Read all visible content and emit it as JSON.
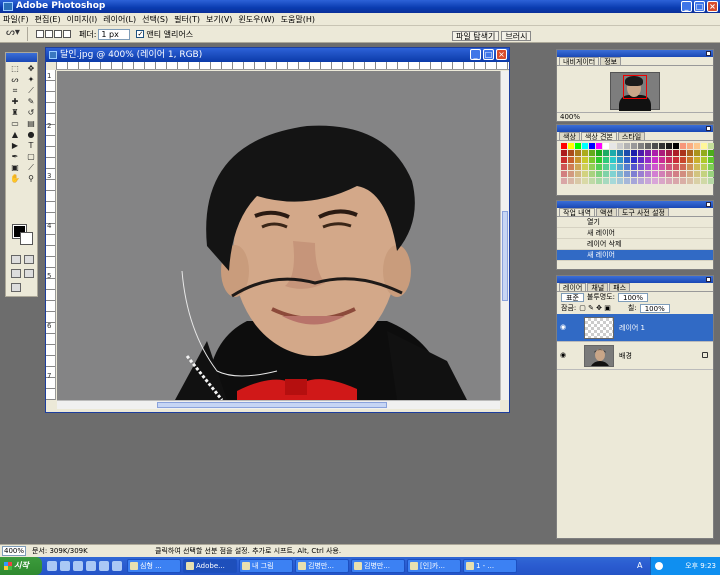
{
  "app": {
    "title": "Adobe Photoshop"
  },
  "menu": [
    "파일(F)",
    "편집(E)",
    "이미지(I)",
    "레이어(L)",
    "선택(S)",
    "필터(T)",
    "보기(V)",
    "윈도우(W)",
    "도움말(H)"
  ],
  "options": {
    "feather_label": "페더:",
    "feather_value": "1 px",
    "antialias_label": "앤티 앨리어스",
    "well_tabs": [
      "파일 탐색기",
      "브러시"
    ]
  },
  "document": {
    "title": "달인.jpg @ 400% (레이어 1, RGB)",
    "ruler_ticks": [
      "1",
      "2",
      "3",
      "4",
      "5",
      "6",
      "7"
    ]
  },
  "navigator": {
    "tabs": [
      "내비게이터",
      "정보"
    ],
    "zoom": "400%"
  },
  "color": {
    "tabs": [
      "색상",
      "색상 견본",
      "스타일"
    ],
    "swatches": [
      "#ff0000",
      "#ffff00",
      "#00ff00",
      "#00ffff",
      "#0000ff",
      "#ff00ff",
      "#ffffff",
      "#e6e6e6",
      "#cccccc",
      "#b3b3b3",
      "#999999",
      "#808080",
      "#666666",
      "#4d4d4d",
      "#333333",
      "#1a1a1a",
      "#000000",
      "#f7977a",
      "#f9ad81",
      "#fdc68a",
      "#fff79a",
      "#c4df9b"
    ]
  },
  "history": {
    "tabs": [
      "작업 내역",
      "액션",
      "도구 사전 설정"
    ],
    "items": [
      "열기",
      "새 레이어",
      "레이어 삭제",
      "새 레이어"
    ]
  },
  "layers": {
    "tabs": [
      "레이어",
      "채널",
      "패스"
    ],
    "blend_mode": "표준",
    "opacity_label": "불투명도:",
    "opacity_value": "100%",
    "lock_label": "잠금:",
    "fill_label": "칠:",
    "fill_value": "100%",
    "items": [
      {
        "name": "레이어 1"
      },
      {
        "name": "배경"
      }
    ]
  },
  "status": {
    "zoom": "400%",
    "doc_info": "문서: 309K/309K",
    "message": "클릭하여 선택할 선분 점을 설정. 추가로 시프트, Alt, Ctrl 사용."
  },
  "taskbar": {
    "start_label": "시작",
    "tasks": [
      "심형 ...",
      "Adobe...",
      "내 그림",
      "김병만...",
      "김병만...",
      "[인]카...",
      "1 - ..."
    ],
    "ime": "A",
    "clock": "오후 9:23"
  }
}
